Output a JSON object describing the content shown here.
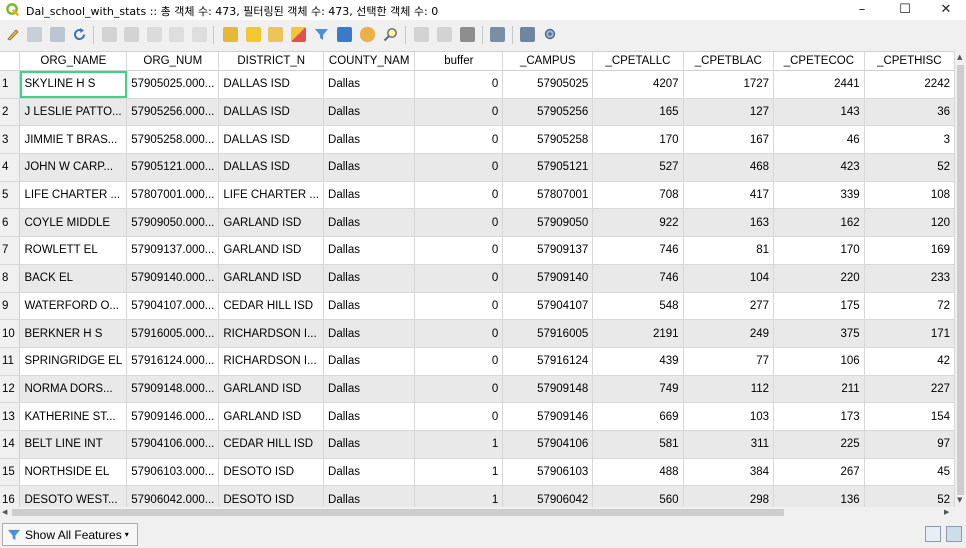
{
  "window": {
    "title": "Dal_school_with_stats :: 총 객체 수: 473, 필터링된 객체 수: 473, 선택한 객체 수: 0",
    "minimize": "–",
    "maximize": "☐",
    "close": "✕"
  },
  "toolbar": {
    "icons": [
      "edit-pencil-icon",
      "multi-edit-icon",
      "save-icon",
      "reload-icon",
      "add-feature-icon",
      "delete-feature-icon",
      "cut-icon",
      "copy-icon",
      "paste-icon",
      "select-expression-icon",
      "select-all-icon",
      "invert-selection-icon",
      "deselect-icon",
      "filter-icon",
      "move-selection-top-icon",
      "pan-to-selection-icon",
      "zoom-to-selection-icon",
      "copy-rows-icon",
      "paste-rows-icon",
      "field-calculator-icon",
      "conditional-format-icon",
      "dock-icon",
      "actions-icon"
    ]
  },
  "table": {
    "columns": [
      "ORG_NAME",
      "ORG_NUM",
      "DISTRICT_N",
      "COUNTY_NAM",
      "buffer",
      "_CAMPUS",
      "_CPETALLC",
      "_CPETBLAC",
      "_CPETECOC",
      "_CPETHISC"
    ],
    "rows": [
      {
        "n": "1",
        "org_name": "SKYLINE H S",
        "org_num": "57905025.000...",
        "district": "DALLAS ISD",
        "county": "Dallas",
        "buffer": "0",
        "campus": "57905025",
        "allc": "4207",
        "blac": "1727",
        "ecoc": "2441",
        "hisc": "2242"
      },
      {
        "n": "2",
        "org_name": "J LESLIE PATTO...",
        "org_num": "57905256.000...",
        "district": "DALLAS ISD",
        "county": "Dallas",
        "buffer": "0",
        "campus": "57905256",
        "allc": "165",
        "blac": "127",
        "ecoc": "143",
        "hisc": "36"
      },
      {
        "n": "3",
        "org_name": "JIMMIE T BRAS...",
        "org_num": "57905258.000...",
        "district": "DALLAS ISD",
        "county": "Dallas",
        "buffer": "0",
        "campus": "57905258",
        "allc": "170",
        "blac": "167",
        "ecoc": "46",
        "hisc": "3"
      },
      {
        "n": "4",
        "org_name": "JOHN W CARP...",
        "org_num": "57905121.000...",
        "district": "DALLAS ISD",
        "county": "Dallas",
        "buffer": "0",
        "campus": "57905121",
        "allc": "527",
        "blac": "468",
        "ecoc": "423",
        "hisc": "52"
      },
      {
        "n": "5",
        "org_name": "LIFE CHARTER ...",
        "org_num": "57807001.000...",
        "district": "LIFE CHARTER ...",
        "county": "Dallas",
        "buffer": "0",
        "campus": "57807001",
        "allc": "708",
        "blac": "417",
        "ecoc": "339",
        "hisc": "108"
      },
      {
        "n": "6",
        "org_name": "COYLE MIDDLE",
        "org_num": "57909050.000...",
        "district": "GARLAND ISD",
        "county": "Dallas",
        "buffer": "0",
        "campus": "57909050",
        "allc": "922",
        "blac": "163",
        "ecoc": "162",
        "hisc": "120"
      },
      {
        "n": "7",
        "org_name": "ROWLETT EL",
        "org_num": "57909137.000...",
        "district": "GARLAND ISD",
        "county": "Dallas",
        "buffer": "0",
        "campus": "57909137",
        "allc": "746",
        "blac": "81",
        "ecoc": "170",
        "hisc": "169"
      },
      {
        "n": "8",
        "org_name": "BACK EL",
        "org_num": "57909140.000...",
        "district": "GARLAND ISD",
        "county": "Dallas",
        "buffer": "0",
        "campus": "57909140",
        "allc": "746",
        "blac": "104",
        "ecoc": "220",
        "hisc": "233"
      },
      {
        "n": "9",
        "org_name": "WATERFORD O...",
        "org_num": "57904107.000...",
        "district": "CEDAR HILL ISD",
        "county": "Dallas",
        "buffer": "0",
        "campus": "57904107",
        "allc": "548",
        "blac": "277",
        "ecoc": "175",
        "hisc": "72"
      },
      {
        "n": "10",
        "org_name": "BERKNER H S",
        "org_num": "57916005.000...",
        "district": "RICHARDSON I...",
        "county": "Dallas",
        "buffer": "0",
        "campus": "57916005",
        "allc": "2191",
        "blac": "249",
        "ecoc": "375",
        "hisc": "171"
      },
      {
        "n": "11",
        "org_name": "SPRINGRIDGE EL",
        "org_num": "57916124.000...",
        "district": "RICHARDSON I...",
        "county": "Dallas",
        "buffer": "0",
        "campus": "57916124",
        "allc": "439",
        "blac": "77",
        "ecoc": "106",
        "hisc": "42"
      },
      {
        "n": "12",
        "org_name": "NORMA DORS...",
        "org_num": "57909148.000...",
        "district": "GARLAND ISD",
        "county": "Dallas",
        "buffer": "0",
        "campus": "57909148",
        "allc": "749",
        "blac": "112",
        "ecoc": "211",
        "hisc": "227"
      },
      {
        "n": "13",
        "org_name": "KATHERINE ST...",
        "org_num": "57909146.000...",
        "district": "GARLAND ISD",
        "county": "Dallas",
        "buffer": "0",
        "campus": "57909146",
        "allc": "669",
        "blac": "103",
        "ecoc": "173",
        "hisc": "154"
      },
      {
        "n": "14",
        "org_name": "BELT LINE INT",
        "org_num": "57904106.000...",
        "district": "CEDAR HILL ISD",
        "county": "Dallas",
        "buffer": "1",
        "campus": "57904106",
        "allc": "581",
        "blac": "311",
        "ecoc": "225",
        "hisc": "97"
      },
      {
        "n": "15",
        "org_name": "NORTHSIDE EL",
        "org_num": "57906103.000...",
        "district": "DESOTO ISD",
        "county": "Dallas",
        "buffer": "1",
        "campus": "57906103",
        "allc": "488",
        "blac": "384",
        "ecoc": "267",
        "hisc": "45"
      },
      {
        "n": "16",
        "org_name": "DESOTO WEST...",
        "org_num": "57906042.000...",
        "district": "DESOTO ISD",
        "county": "Dallas",
        "buffer": "1",
        "campus": "57906042",
        "allc": "560",
        "blac": "298",
        "ecoc": "136",
        "hisc": "52"
      }
    ]
  },
  "bottom": {
    "show_all_label": "Show All Features",
    "show_all_icon": "filter-icon"
  },
  "colors": {
    "selected_cell_border": "#3cd38a",
    "alt_row": "#e9e9e9",
    "qgis_green": "#76b82a"
  }
}
